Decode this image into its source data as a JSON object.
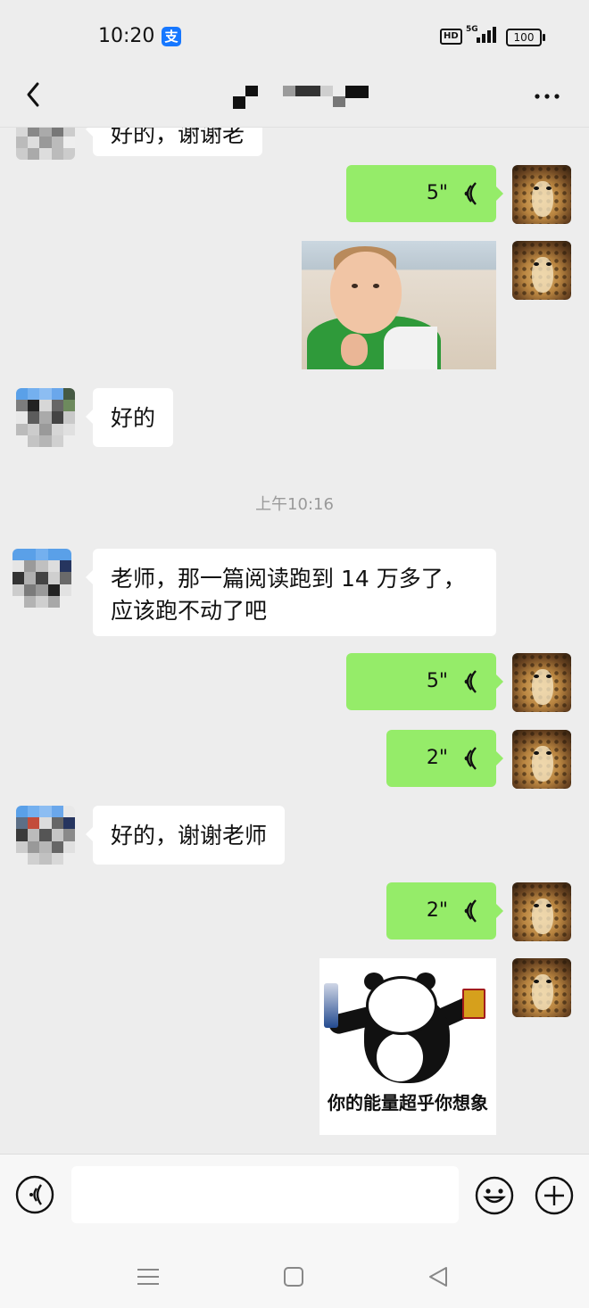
{
  "status_bar": {
    "time": "10:20",
    "alipay_label": "支",
    "hd_label": "HD",
    "network_label": "5G",
    "battery": "100"
  },
  "header": {
    "title_visible": false
  },
  "messages": {
    "m1_text": "好的，谢谢老",
    "m2_voice": "5\"",
    "m4_text": "好的",
    "timestamp": "上午10:16",
    "m5_text_line1": "老师，那一篇阅读跑到 14 万多了，",
    "m5_text_line2": "应该跑不动了吧",
    "m6_voice": "5\"",
    "m7_voice": "2\"",
    "m8_text": "好的，谢谢老师",
    "m9_voice": "2\"",
    "sticker_caption": "你的能量超乎你想象"
  },
  "colors": {
    "self_bubble": "#95ec69",
    "other_bubble": "#ffffff",
    "background": "#ededed"
  }
}
